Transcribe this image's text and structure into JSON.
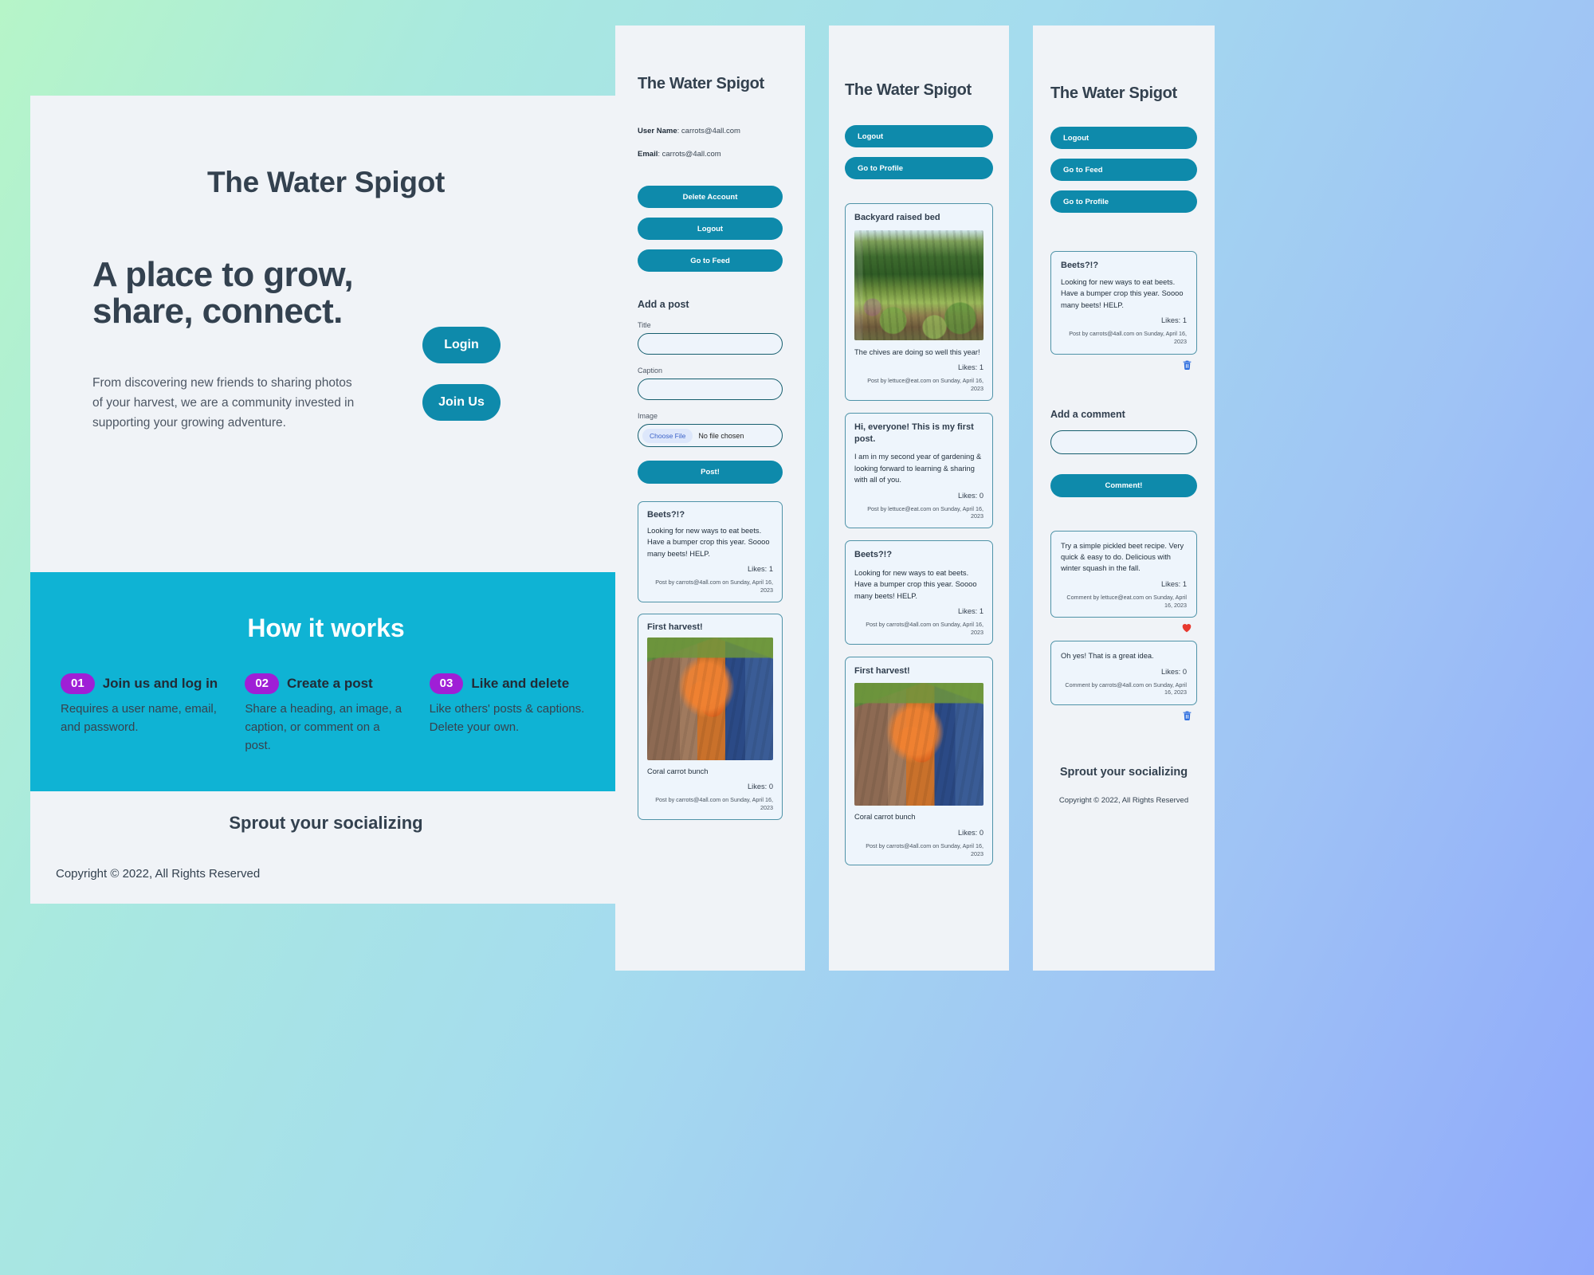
{
  "app": {
    "name": "The Water Spigot"
  },
  "landing": {
    "brand": "The Water Spigot",
    "headline": "A place to grow, share, connect.",
    "subtext": "From discovering new friends to sharing photos of your harvest, we are a community invested in supporting your growing adventure.",
    "login_label": "Login",
    "join_label": "Join Us",
    "works_title": "How it works",
    "steps": [
      {
        "number": "01",
        "heading": "Join us and log in",
        "text": "Requires a user name, email, and password."
      },
      {
        "number": "02",
        "heading": "Create a post",
        "text": "Share a heading, an image, a caption, or comment on a post."
      },
      {
        "number": "03",
        "heading": "Like and delete",
        "text": "Like others' posts & captions. Delete your own."
      }
    ],
    "sprout": "Sprout your socializing",
    "copyright": "Copyright © 2022, All Rights Reserved"
  },
  "profile": {
    "brand": "The Water Spigot",
    "user_name_label": "User Name",
    "user_name_value": "carrots@4all.com",
    "email_label": "Email",
    "email_value": "carrots@4all.com",
    "buttons": [
      {
        "label": "Delete Account",
        "name": "delete-account-button"
      },
      {
        "label": "Logout",
        "name": "logout-button"
      },
      {
        "label": "Go to Feed",
        "name": "go-to-feed-button"
      }
    ],
    "add_post_title": "Add a post",
    "title_label": "Title",
    "title_value": "",
    "title_placeholder": "",
    "caption_label": "Caption",
    "caption_value": "",
    "caption_placeholder": "",
    "image_label": "Image",
    "choose_file_label": "Choose File",
    "no_file_label": "No file chosen",
    "post_button_label": "Post!",
    "posts": [
      {
        "title": "Beets?!?",
        "body": "Looking for new ways to eat beets. Have a bumper crop this year. Soooo many beets! HELP.",
        "likes": "Likes: 1",
        "meta": "Post by carrots@4all.com on Sunday, April 16, 2023",
        "image": "none",
        "caption": ""
      },
      {
        "title": "First harvest!",
        "body": "",
        "caption": "Coral carrot bunch",
        "likes": "Likes: 0",
        "meta": "Post by carrots@4all.com on Sunday, April 16, 2023",
        "image": "carrots"
      }
    ]
  },
  "feed": {
    "brand": "The Water Spigot",
    "buttons": [
      {
        "label": "Logout",
        "name": "logout-button"
      },
      {
        "label": "Go to Profile",
        "name": "go-to-profile-button"
      }
    ],
    "posts": [
      {
        "title": "Backyard raised bed",
        "image": "garden",
        "body": "The chives are doing so well this year!",
        "likes": "Likes: 1",
        "meta": "Post by lettuce@eat.com on Sunday, April 16, 2023"
      },
      {
        "title": "Hi, everyone! This is my first post.",
        "image": "none",
        "body": "I am in my second year of gardening & looking forward to learning & sharing with all of you.",
        "likes": "Likes: 0",
        "meta": "Post by lettuce@eat.com on Sunday, April 16, 2023"
      },
      {
        "title": "Beets?!?",
        "image": "none",
        "body": "Looking for new ways to eat beets. Have a bumper crop this year. Soooo many beets! HELP.",
        "likes": "Likes: 1",
        "meta": "Post by carrots@4all.com on Sunday, April 16, 2023"
      },
      {
        "title": "First harvest!",
        "image": "carrots",
        "body": "Coral carrot bunch",
        "likes": "Likes: 0",
        "meta": "Post by carrots@4all.com on Sunday, April 16, 2023"
      }
    ]
  },
  "post_detail": {
    "brand": "The Water Spigot",
    "buttons": [
      {
        "label": "Logout",
        "name": "logout-button"
      },
      {
        "label": "Go to Feed",
        "name": "go-to-feed-button"
      },
      {
        "label": "Go to Profile",
        "name": "go-to-profile-button"
      }
    ],
    "post": {
      "title": "Beets?!?",
      "body": "Looking for new ways to eat beets. Have a bumper crop this year. Soooo many beets! HELP.",
      "likes": "Likes: 1",
      "meta": "Post by carrots@4all.com on Sunday, April 16, 2023",
      "action_icon": "trash-icon"
    },
    "add_comment_title": "Add a comment",
    "comment_value": "",
    "comment_placeholder": "",
    "comment_button_label": "Comment!",
    "comments": [
      {
        "body": "Try a simple pickled beet recipe. Very quick & easy to do. Delicious with winter squash in the fall.",
        "likes": "Likes: 1",
        "meta": "Comment by lettuce@eat.com on Sunday, April 16, 2023",
        "action_icon": "heart-icon"
      },
      {
        "body": "Oh yes! That is a great idea.",
        "likes": "Likes: 0",
        "meta": "Comment by carrots@4all.com on Sunday, April 16, 2023",
        "action_icon": "trash-icon"
      }
    ],
    "sprout": "Sprout your socializing",
    "copyright": "Copyright © 2022, All Rights Reserved"
  },
  "colors": {
    "teal": "#0e8aab",
    "cyan": "#0fb3d4",
    "purple": "#9f1fd6",
    "dark": "#33414f",
    "panel": "#f0f3f7",
    "heart": "#e8392f",
    "trash": "#2f6fe0"
  }
}
